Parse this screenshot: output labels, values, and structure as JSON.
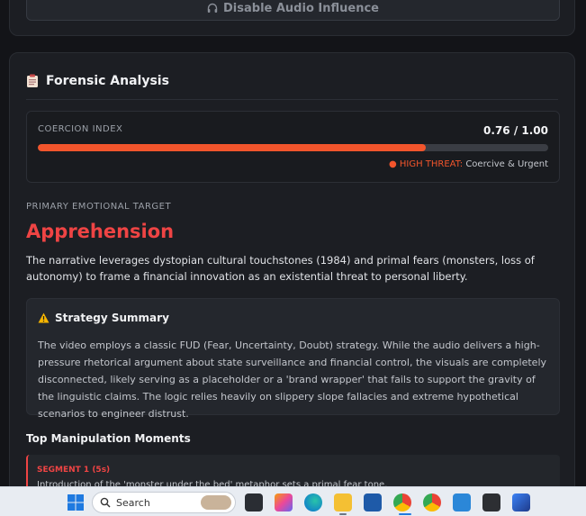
{
  "top_card": {
    "disable_button_label": "Disable Audio Influence",
    "disable_button_icon": "headphones-icon"
  },
  "forensic": {
    "title": "Forensic Analysis",
    "title_icon": "clipboard-icon",
    "coercion": {
      "label": "COERCION INDEX",
      "value": "0.76 / 1.00",
      "fill": 0.76,
      "threat_level": "HIGH THREAT:",
      "threat_desc": "Coercive & Urgent",
      "threat_color": "#f2552c"
    },
    "primary": {
      "label": "PRIMARY EMOTIONAL TARGET",
      "value": "Apprehension",
      "description": "The narrative leverages dystopian cultural touchstones (1984) and primal fears (monsters, loss of autonomy) to frame a financial innovation as an existential threat to personal liberty."
    },
    "strategy": {
      "title": "Strategy Summary",
      "icon": "warning-icon",
      "text": "The video employs a classic FUD (Fear, Uncertainty, Doubt) strategy. While the audio delivers a high-pressure rhetorical argument about state surveillance and financial control, the visuals are completely disconnected, likely serving as a placeholder or a 'brand wrapper' that fails to support the gravity of the linguistic claims. The logic relies heavily on slippery slope fallacies and extreme hypothetical scenarios to engineer distrust."
    },
    "moments": {
      "title": "Top Manipulation Moments",
      "items": [
        {
          "segment": "SEGMENT 1 (5s)",
          "text": "Introduction of the 'monster under the bed' metaphor sets a primal fear tone."
        }
      ]
    }
  },
  "taskbar": {
    "search_placeholder": "Search",
    "start_icon": "windows-start-icon"
  },
  "colors": {
    "accent_red": "#ef4444",
    "accent_orange": "#f2552c",
    "background": "#131418",
    "card": "#1c1e23"
  }
}
